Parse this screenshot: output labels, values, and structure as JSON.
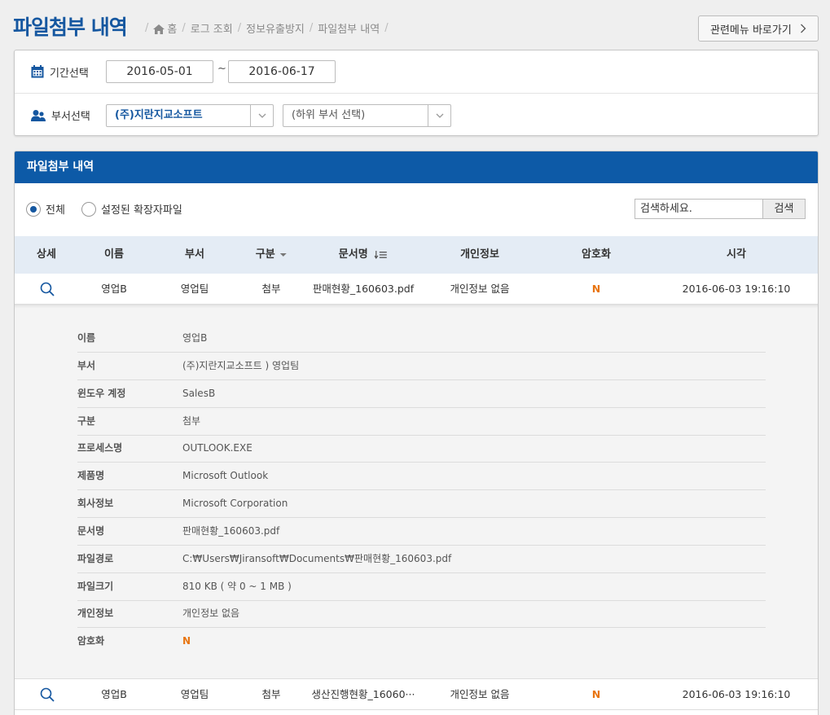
{
  "header": {
    "title": "파일첨부 내역",
    "breadcrumb": [
      "홈",
      "로그 조회",
      "정보유출방지",
      "파일첨부 내역"
    ],
    "related_button": "관련메뉴 바로가기"
  },
  "filters": {
    "period_label": "기간선택",
    "date_from": "2016-05-01",
    "date_sep": "~",
    "date_to": "2016-06-17",
    "dept_label": "부서선택",
    "dept_selected": "(주)지란지교소프트",
    "sub_dept_selected": "(하위 부서 선택)"
  },
  "panel": {
    "title": "파일첨부 내역",
    "radio_all": "전체",
    "radio_ext": "설정된 확장자파일",
    "search_placeholder": "검색하세요.",
    "search_button": "검색"
  },
  "columns": {
    "detail": "상세",
    "name": "이름",
    "dept": "부서",
    "type": "구분",
    "doc": "문서명",
    "privacy": "개인정보",
    "encrypt": "암호화",
    "time": "시각"
  },
  "rows": [
    {
      "name": "영업B",
      "dept": "영업팀",
      "type": "첨부",
      "doc": "판매현황_160603.pdf",
      "privacy": "개인정보 없음",
      "encrypt": "N",
      "time": "2016-06-03 19:16:10"
    },
    {
      "name": "영업B",
      "dept": "영업팀",
      "type": "첨부",
      "doc": "생산진행현황_16060···",
      "privacy": "개인정보 없음",
      "encrypt": "N",
      "time": "2016-06-03 19:16:10"
    }
  ],
  "detail": [
    {
      "label": "이름",
      "value": "영업B"
    },
    {
      "label": "부서",
      "value": "(주)지란지교소프트 ) 영업팀"
    },
    {
      "label": "윈도우 계정",
      "value": "SalesB"
    },
    {
      "label": "구분",
      "value": "첨부"
    },
    {
      "label": "프로세스명",
      "value": "OUTLOOK.EXE"
    },
    {
      "label": "제품명",
      "value": "Microsoft Outlook"
    },
    {
      "label": "회사정보",
      "value": "Microsoft Corporation"
    },
    {
      "label": "문서명",
      "value": "판매현황_160603.pdf"
    },
    {
      "label": "파일경로",
      "value": "C:₩Users₩Jiransoft₩Documents₩판매현황_160603.pdf"
    },
    {
      "label": "파일크기",
      "value": "810 KB ( 약 0 ~ 1 MB )"
    },
    {
      "label": "개인정보",
      "value": "개인정보 없음"
    },
    {
      "label": "암호화",
      "value": "N"
    }
  ],
  "colors": {
    "brand": "#1557a0",
    "header_bar": "#0d5aa7",
    "accent_n": "#e87511"
  },
  "icons": [
    "home-icon",
    "chevron-right-icon",
    "calendar-icon",
    "people-icon",
    "chevron-down-icon",
    "sort-down-icon",
    "sort-list-icon",
    "magnifier-icon"
  ]
}
